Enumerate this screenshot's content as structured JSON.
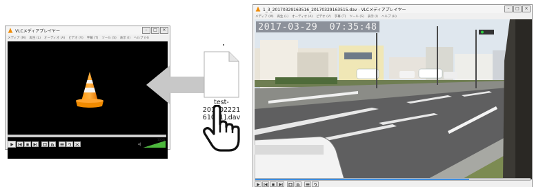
{
  "left_window": {
    "title": "VLCメディアプレイヤー",
    "menu": [
      "メディア (M)",
      "再生 (L)",
      "オーディオ (A)",
      "ビデオ (V)",
      "字幕 (T)",
      "ツール (S)",
      "表示 (I)",
      "ヘルプ (H)"
    ],
    "volume_percent": "100%",
    "volume_level": 1.0,
    "seek_position": 0
  },
  "file": {
    "name_line1": "test-201602221",
    "name_line2": "61081].dav"
  },
  "right_window": {
    "title": "1_3_20170329163516_20170329163515.dav - VLCメディアプレイヤー",
    "menu": [
      "メディア (M)",
      "再生 (L)",
      "オーディオ (A)",
      "ビデオ (V)",
      "字幕 (T)",
      "ツール (S)",
      "表示 (I)",
      "ヘルプ (H)"
    ],
    "timestamp": "2017-03-29  07:35:48",
    "seek_position": 0.78
  },
  "colors": {
    "vlc_orange": "#f08a00",
    "arrow_gray": "#c8c8c8",
    "seek_blue": "#3c8de0"
  },
  "icons": {
    "app_icon": "vlc-cone-icon",
    "file": "document-icon",
    "pointer": "hand-pointer-icon",
    "drag_arrow": "arrow-left-icon"
  }
}
